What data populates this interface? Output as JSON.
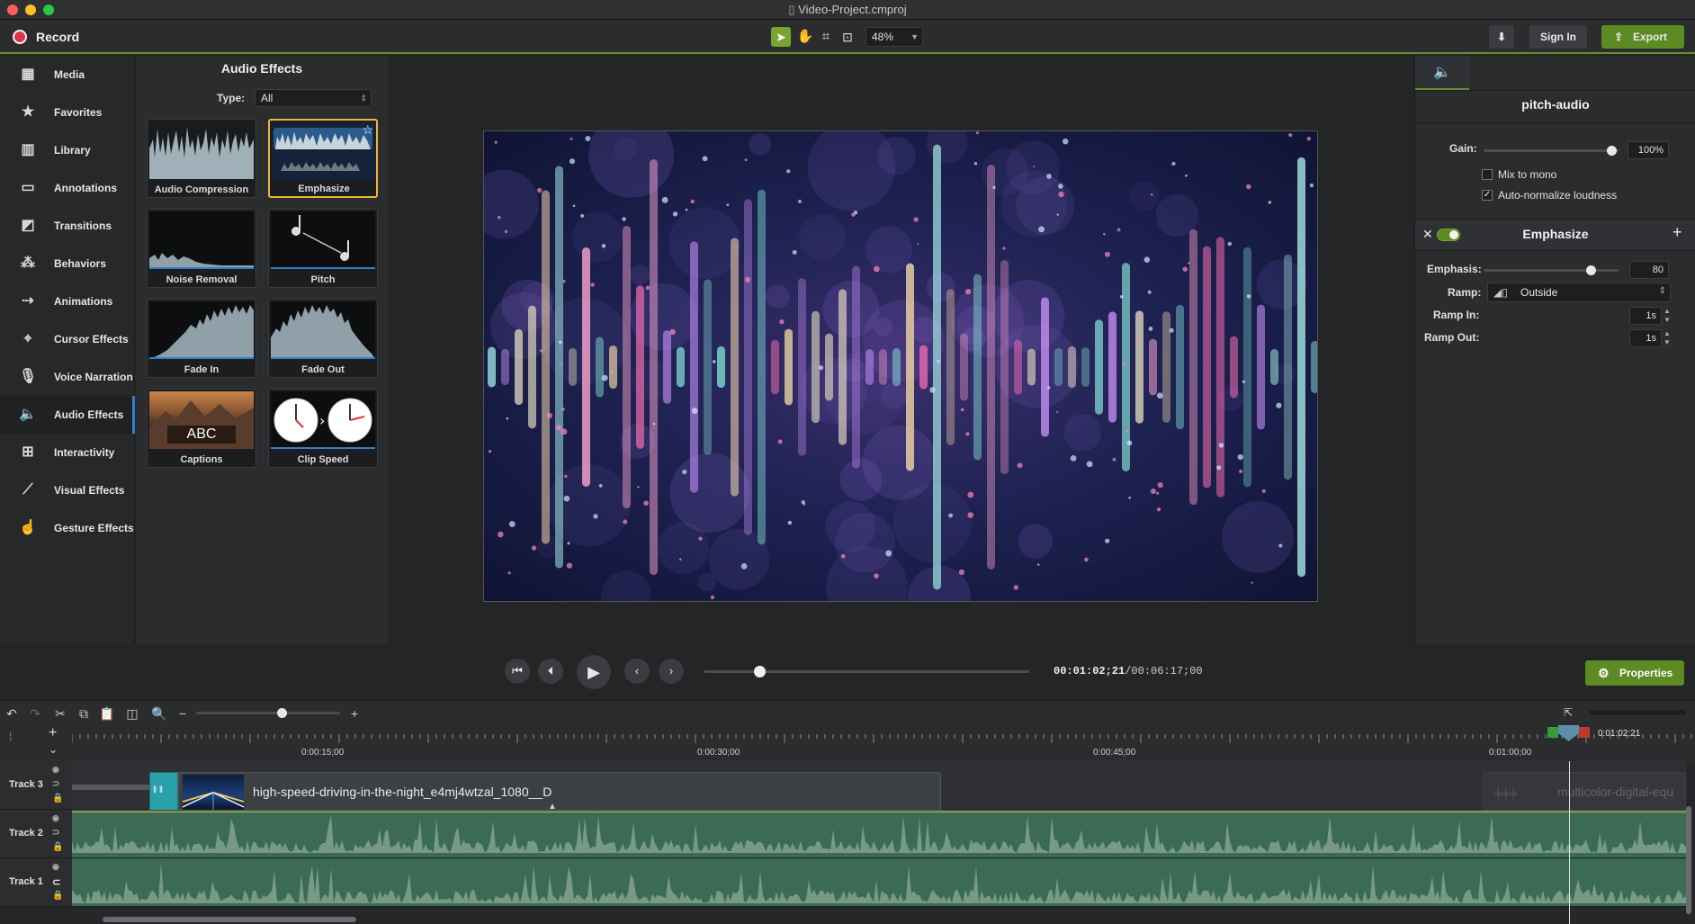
{
  "window": {
    "title": "Video-Project.cmproj"
  },
  "toolbar": {
    "record_label": "Record",
    "zoom_value": "48%",
    "signin_label": "Sign In",
    "export_label": "Export",
    "accent": "#6a8c2c",
    "record_color": "#e0344a"
  },
  "sidebar": {
    "items": [
      {
        "label": "Media",
        "icon": "film-strip-icon"
      },
      {
        "label": "Favorites",
        "icon": "star-icon"
      },
      {
        "label": "Library",
        "icon": "library-books-icon"
      },
      {
        "label": "Annotations",
        "icon": "annotation-icon"
      },
      {
        "label": "Transitions",
        "icon": "transition-icon"
      },
      {
        "label": "Behaviors",
        "icon": "behavior-icon"
      },
      {
        "label": "Animations",
        "icon": "animation-arrow-icon"
      },
      {
        "label": "Cursor Effects",
        "icon": "cursor-icon"
      },
      {
        "label": "Voice Narration",
        "icon": "microphone-icon"
      },
      {
        "label": "Audio Effects",
        "icon": "speaker-icon"
      },
      {
        "label": "Interactivity",
        "icon": "interactivity-icon"
      },
      {
        "label": "Visual Effects",
        "icon": "magic-wand-icon"
      },
      {
        "label": "Gesture Effects",
        "icon": "hand-gesture-icon"
      }
    ],
    "active_index": 9
  },
  "effects": {
    "title": "Audio Effects",
    "type_label": "Type:",
    "type_value": "All",
    "tiles": [
      {
        "label": "Audio Compression"
      },
      {
        "label": "Emphasize"
      },
      {
        "label": "Noise Removal"
      },
      {
        "label": "Pitch"
      },
      {
        "label": "Fade In"
      },
      {
        "label": "Fade Out"
      },
      {
        "label": "Captions",
        "thumb_text": "ABC"
      },
      {
        "label": "Clip Speed"
      }
    ],
    "selected": "Emphasize"
  },
  "properties": {
    "clip_name": "pitch-audio",
    "gain_label": "Gain:",
    "gain_value": "100%",
    "gain_level": 0.95,
    "mix_mono_label": "Mix to mono",
    "mix_mono_checked": false,
    "auto_norm_label": "Auto-normalize loudness",
    "auto_norm_checked": true,
    "effect_title": "Emphasize",
    "emphasis_label": "Emphasis:",
    "emphasis_value": "80",
    "emphasis_level": 0.8,
    "ramp_label": "Ramp:",
    "ramp_value": "Outside",
    "ramp_in_label": "Ramp In:",
    "ramp_in_value": "1s",
    "ramp_out_label": "Ramp Out:",
    "ramp_out_value": "1s",
    "properties_button": "Properties"
  },
  "playback": {
    "time_current": "00:01:02;21",
    "time_total": "00:06:17;00",
    "time_sep": "/",
    "progress": 0.17
  },
  "timeline": {
    "ruler_labels": [
      "0:00:15;00",
      "0:00:30;00",
      "0:00:45;00",
      "0:01:00;00"
    ],
    "playhead_label": "0:01:02;21",
    "tracks": [
      {
        "name": "Track 3",
        "clip": "high-speed-driving-in-the-night_e4mj4wtzal_1080__D",
        "ghost_clip": "multicolor-digital-equ"
      },
      {
        "name": "Track 2"
      },
      {
        "name": "Track 1"
      }
    ]
  }
}
